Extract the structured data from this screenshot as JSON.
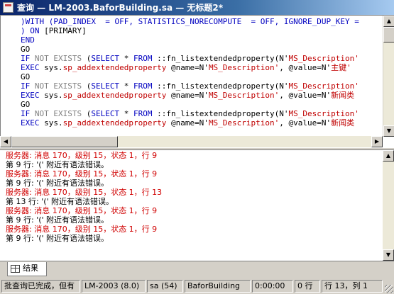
{
  "window": {
    "title": "查询 — LM-2003.BaforBuilding.sa — 无标题2*"
  },
  "editor": {
    "lines": [
      {
        "segments": [
          {
            "t": ")WITH (PAD_INDEX  = OFF, STATISTICS_NORECOMPUTE  = OFF, IGNORE_DUP_KEY = ",
            "c": "kw"
          }
        ]
      },
      {
        "segments": [
          {
            "t": ") ON ",
            "c": "kw"
          },
          {
            "t": "[PRIMARY]",
            "c": "plain"
          }
        ]
      },
      {
        "segments": [
          {
            "t": "END",
            "c": "kw"
          }
        ]
      },
      {
        "segments": [
          {
            "t": "GO",
            "c": "plain"
          }
        ]
      },
      {
        "segments": [
          {
            "t": "IF ",
            "c": "kw"
          },
          {
            "t": "NOT EXISTS",
            "c": "gray"
          },
          {
            "t": " (",
            "c": "plain"
          },
          {
            "t": "SELECT",
            "c": "kw"
          },
          {
            "t": " * ",
            "c": "plain"
          },
          {
            "t": "FROM",
            "c": "kw"
          },
          {
            "t": " ::fn_listextendedproperty(N'",
            "c": "plain"
          },
          {
            "t": "MS_Description'",
            "c": "str"
          }
        ]
      },
      {
        "segments": [
          {
            "t": "EXEC",
            "c": "kw"
          },
          {
            "t": " sys.",
            "c": "plain"
          },
          {
            "t": "sp_addextendedproperty",
            "c": "str"
          },
          {
            "t": " @name=N'",
            "c": "plain"
          },
          {
            "t": "MS_Description'",
            "c": "str"
          },
          {
            "t": ", @value=N'",
            "c": "plain"
          },
          {
            "t": "主键'",
            "c": "str"
          }
        ]
      },
      {
        "segments": [
          {
            "t": "GO",
            "c": "plain"
          }
        ]
      },
      {
        "segments": [
          {
            "t": "IF ",
            "c": "kw"
          },
          {
            "t": "NOT EXISTS",
            "c": "gray"
          },
          {
            "t": " (",
            "c": "plain"
          },
          {
            "t": "SELECT",
            "c": "kw"
          },
          {
            "t": " * ",
            "c": "plain"
          },
          {
            "t": "FROM",
            "c": "kw"
          },
          {
            "t": " ::fn_listextendedproperty(N'",
            "c": "plain"
          },
          {
            "t": "MS_Description'",
            "c": "str"
          }
        ]
      },
      {
        "segments": [
          {
            "t": "EXEC",
            "c": "kw"
          },
          {
            "t": " sys.",
            "c": "plain"
          },
          {
            "t": "sp_addextendedproperty",
            "c": "str"
          },
          {
            "t": " @name=N'",
            "c": "plain"
          },
          {
            "t": "MS_Description'",
            "c": "str"
          },
          {
            "t": ", @value=N'",
            "c": "plain"
          },
          {
            "t": "新闻类",
            "c": "str"
          }
        ]
      },
      {
        "segments": [
          {
            "t": "GO",
            "c": "plain"
          }
        ]
      },
      {
        "segments": [
          {
            "t": "IF ",
            "c": "kw"
          },
          {
            "t": "NOT EXISTS",
            "c": "gray"
          },
          {
            "t": " (",
            "c": "plain"
          },
          {
            "t": "SELECT",
            "c": "kw"
          },
          {
            "t": " * ",
            "c": "plain"
          },
          {
            "t": "FROM",
            "c": "kw"
          },
          {
            "t": " ::fn_listextendedproperty(N'",
            "c": "plain"
          },
          {
            "t": "MS_Description'",
            "c": "str"
          }
        ]
      },
      {
        "segments": [
          {
            "t": "EXEC",
            "c": "kw"
          },
          {
            "t": " sys.",
            "c": "plain"
          },
          {
            "t": "sp_addextendedproperty",
            "c": "str"
          },
          {
            "t": " @name=N'",
            "c": "plain"
          },
          {
            "t": "MS_Description'",
            "c": "str"
          },
          {
            "t": ", @value=N'",
            "c": "plain"
          },
          {
            "t": "新闻类",
            "c": "str"
          }
        ]
      }
    ]
  },
  "results": {
    "lines": [
      {
        "text": "服务器: 消息 170，级别 15，状态 1，行 9",
        "kind": "err"
      },
      {
        "text": "第 9 行: '(' 附近有语法错误。",
        "kind": "msg"
      },
      {
        "text": "服务器: 消息 170，级别 15，状态 1，行 9",
        "kind": "err"
      },
      {
        "text": "第 9 行: '(' 附近有语法错误。",
        "kind": "msg"
      },
      {
        "text": "服务器: 消息 170，级别 15，状态 1，行 13",
        "kind": "err"
      },
      {
        "text": "第 13 行: '(' 附近有语法错误。",
        "kind": "msg"
      },
      {
        "text": "服务器: 消息 170，级别 15，状态 1，行 9",
        "kind": "err"
      },
      {
        "text": "第 9 行: '(' 附近有语法错误。",
        "kind": "msg"
      },
      {
        "text": "服务器: 消息 170，级别 15，状态 1，行 9",
        "kind": "err"
      },
      {
        "text": "第 9 行: '(' 附近有语法错误。",
        "kind": "msg"
      }
    ]
  },
  "tabs": {
    "results_label": "结果"
  },
  "status": {
    "message": "批查询已完成，但有",
    "server": "LM-2003 (8.0)",
    "user": "sa (54)",
    "database": "BaforBuilding",
    "elapsed": "0:00:00",
    "rows": "0 行",
    "position": "行 13，列 1"
  },
  "colors": {
    "keyword": "#0000c0",
    "string": "#c00000",
    "error": "#d00000",
    "titlebar": "#0a246a"
  },
  "icons": {
    "title": "query-document-icon",
    "results_tab": "grid-icon"
  }
}
